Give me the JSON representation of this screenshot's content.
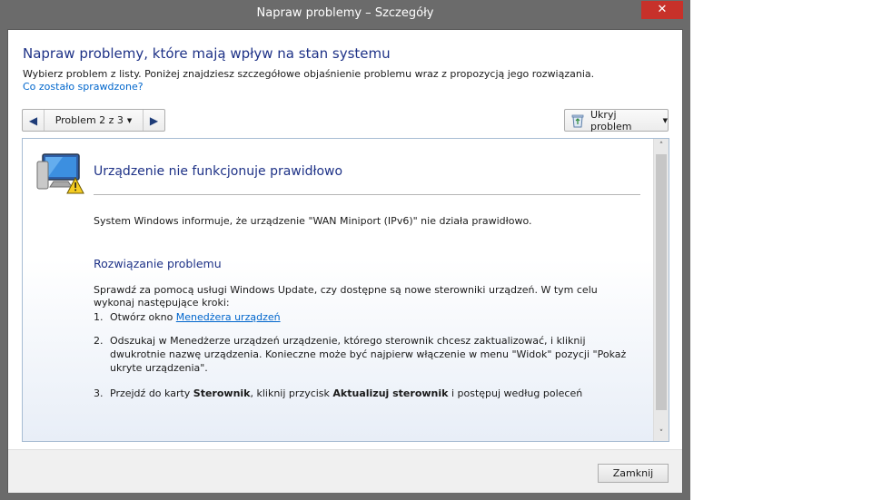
{
  "window": {
    "title": "Napraw problemy – Szczegóły",
    "close_glyph": "✕"
  },
  "header": {
    "title": "Napraw problemy, które mają wpływ na stan systemu",
    "description": "Wybierz problem z listy. Poniżej znajdziesz szczegółowe objaśnienie problemu wraz z propozycją jego rozwiązania.",
    "link": "Co zostało sprawdzone?"
  },
  "nav": {
    "prev_glyph": "◀",
    "next_glyph": "▶",
    "problem_label": "Problem 2 z 3",
    "caret": "▼"
  },
  "hide_button": {
    "label": "Ukryj problem",
    "caret": "▼",
    "icon": "recycle-bin-icon"
  },
  "problem": {
    "icon": "device-warning-icon",
    "title": "Urządzenie nie funkcjonuje prawidłowo",
    "description": "System Windows informuje, że urządzenie \"WAN Miniport (IPv6)\" nie działa prawidłowo."
  },
  "solution": {
    "title": "Rozwiązanie problemu",
    "intro": "Sprawdź za pomocą usługi Windows Update, czy dostępne są nowe sterowniki urządzeń. W tym celu wykonaj następujące kroki:",
    "step1": {
      "num": "1.",
      "text_before": "Otwórz okno ",
      "link": "Menedżera urządzeń"
    },
    "step2": {
      "num": "2.",
      "text": "Odszukaj w Menedżerze urządzeń urządzenie, którego sterownik chcesz zaktualizować, i kliknij dwukrotnie nazwę urządzenia. Konieczne może być najpierw włączenie w menu \"Widok\" pozycji \"Pokaż ukryte urządzenia\"."
    },
    "step3": {
      "num": "3.",
      "text_a": "Przejdź do karty ",
      "bold_a": "Sterownik",
      "text_b": ", kliknij przycisk ",
      "bold_b": "Aktualizuj sterownik",
      "text_c": " i postępuj według poleceń"
    }
  },
  "scrollbar": {
    "up_glyph": "˄",
    "down_glyph": "˅"
  },
  "footer": {
    "close_label": "Zamknij"
  }
}
